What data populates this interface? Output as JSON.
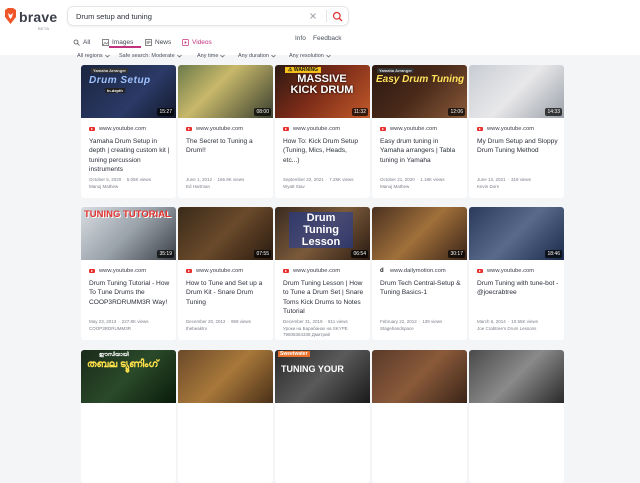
{
  "brand": {
    "name": "brave",
    "tag": "BETA"
  },
  "search": {
    "query": "Drum setup and tuning"
  },
  "tabs": [
    {
      "label": "All",
      "icon": "search-icon"
    },
    {
      "label": "Images",
      "icon": "image-icon"
    },
    {
      "label": "News",
      "icon": "news-icon"
    },
    {
      "label": "Videos",
      "icon": "video-icon",
      "active": true
    }
  ],
  "links": {
    "info": "Info",
    "feedback": "Feedback"
  },
  "filters": [
    "All regions",
    "Safe search: Moderate",
    "Any time",
    "Any duration",
    "Any resolution"
  ],
  "videos": [
    {
      "source": "www.youtube.com",
      "source_icon": "youtube",
      "title": "Yamaha Drum Setup in depth | creating custom kit | tuning percussion instruments",
      "date": "October 5, 2020",
      "views": "5.05K views",
      "channel": "Manoj Mathew",
      "duration": "15:27",
      "overlay": "Drum Setup",
      "overlay_top": "Yamaha Arranger",
      "overlay_sub": "In-depth"
    },
    {
      "source": "www.youtube.com",
      "source_icon": "youtube",
      "title": "The Secret to Tuning a Drum!!",
      "date": "June 1, 2012",
      "views": "166.9K views",
      "channel": "Ed Hartman",
      "duration": "08:00",
      "overlay": ""
    },
    {
      "source": "www.youtube.com",
      "source_icon": "youtube",
      "title": "How To: Kick Drum Setup (Tuning, Mics, Heads, etc...)",
      "date": "September 22, 2021",
      "views": "7.25K views",
      "channel": "Wyatt Stav",
      "duration": "11:32",
      "overlay": "MASSIVE KICK DRUM",
      "overlay_top": "⚠ WARNING"
    },
    {
      "source": "www.youtube.com",
      "source_icon": "youtube",
      "title": "Easy drum tuning in Yamaha arrangers | Tabla tuning in Yamaha",
      "date": "October 21, 2020",
      "views": "1.18K views",
      "channel": "Manoj Mathew",
      "duration": "12:06",
      "overlay": "Easy Drum Tuning",
      "overlay_top": "Yamaha Arranger"
    },
    {
      "source": "www.youtube.com",
      "source_icon": "youtube",
      "title": "My Drum Setup and Sloppy Drum Tuning Method",
      "date": "June 13, 2021",
      "views": "318 views",
      "channel": "Kevin Dorn",
      "duration": "14:33",
      "overlay": ""
    },
    {
      "source": "www.youtube.com",
      "source_icon": "youtube",
      "title": "Drum Tuning Tutorial - How To Tune Drums the COOP3RDRUMM3R Way!",
      "date": "May 23, 2013",
      "views": "227.8K views",
      "channel": "COOP3RDRUMM3R",
      "duration": "35:19",
      "overlay": "TUNING TUTORIAL"
    },
    {
      "source": "www.youtube.com",
      "source_icon": "youtube",
      "title": "How to Tune and Set up a Drum Kit - Snare Drum Tuning",
      "date": "December 20, 2012",
      "views": "959 views",
      "channel": "thebeaktrv",
      "duration": "07:55",
      "overlay": ""
    },
    {
      "source": "www.youtube.com",
      "source_icon": "youtube",
      "title": "Drum Tuning Lesson | How to Tune a Drum Set | Snare Toms Kick Drums to Notes Tutorial",
      "date": "December 31, 2019",
      "views": "811 views",
      "channel": "Уроки на Барабанах на SKYPE 79608354338 Дмитрий",
      "duration": "06:54",
      "overlay": "Drum Tuning Lesson"
    },
    {
      "source": "www.dailymotion.com",
      "source_icon": "dailymotion",
      "title": "Drum Tech Central-Setup & Tuning Basics-1",
      "date": "February 22, 2012",
      "views": "139 views",
      "channel": "Stagehandspace",
      "duration": "30:17",
      "overlay": ""
    },
    {
      "source": "www.youtube.com",
      "source_icon": "youtube",
      "title": "Drum Tuning with tune-bot - @joecrabtree",
      "date": "March 6, 2014",
      "views": "10.55K views",
      "channel": "Joe Crabtree's Drum Lessons",
      "duration": "18:46",
      "overlay": ""
    },
    {
      "source": "",
      "source_icon": "",
      "title": "",
      "date": "",
      "views": "",
      "channel": "",
      "duration": "",
      "overlay": "തബല ട്യൂണിംഗ്",
      "overlay_top": "ഈസിയായി"
    },
    {
      "source": "",
      "source_icon": "",
      "title": "",
      "date": "",
      "views": "",
      "channel": "",
      "duration": "",
      "overlay": ""
    },
    {
      "source": "",
      "source_icon": "",
      "title": "",
      "date": "",
      "views": "",
      "channel": "",
      "duration": "",
      "overlay": "TUNING YOUR",
      "overlay_top": "Sweetwater"
    },
    {
      "source": "",
      "source_icon": "",
      "title": "",
      "date": "",
      "views": "",
      "channel": "",
      "duration": "",
      "overlay": ""
    },
    {
      "source": "",
      "source_icon": "",
      "title": "",
      "date": "",
      "views": "",
      "channel": "",
      "duration": "",
      "overlay": ""
    }
  ]
}
